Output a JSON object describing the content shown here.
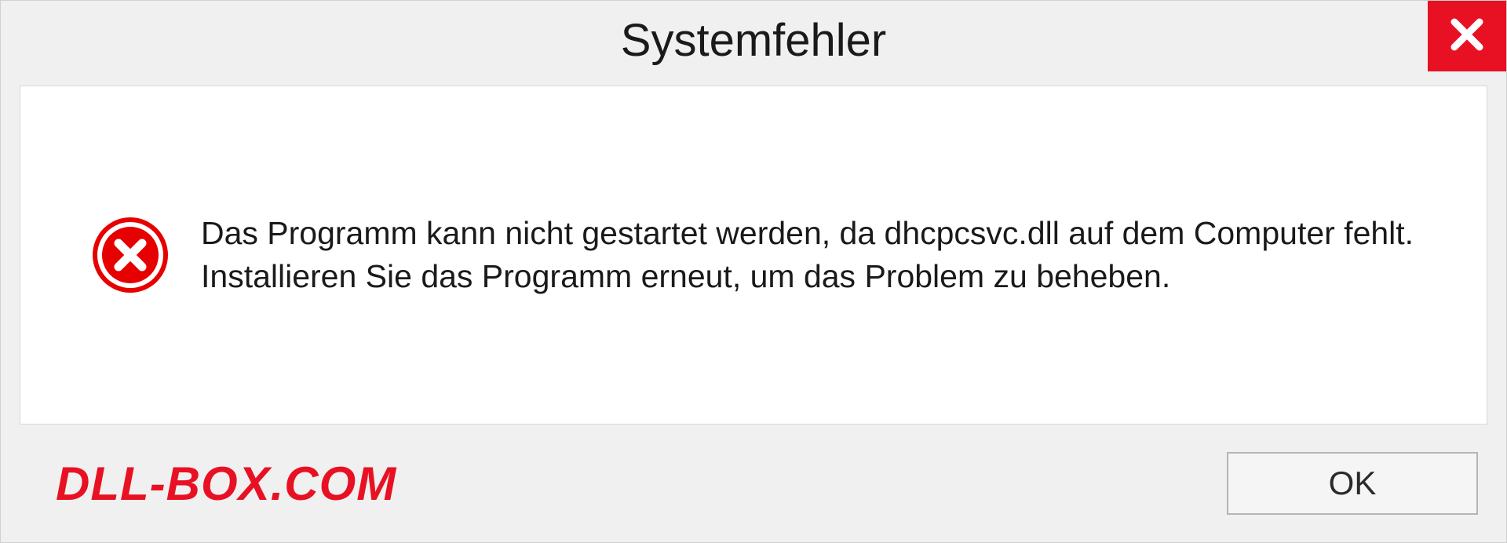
{
  "dialog": {
    "title": "Systemfehler",
    "message": "Das Programm kann nicht gestartet werden, da dhcpcsvc.dll auf dem Computer fehlt. Installieren Sie das Programm erneut, um das Problem zu beheben.",
    "ok_label": "OK",
    "watermark": "DLL-BOX.COM"
  }
}
